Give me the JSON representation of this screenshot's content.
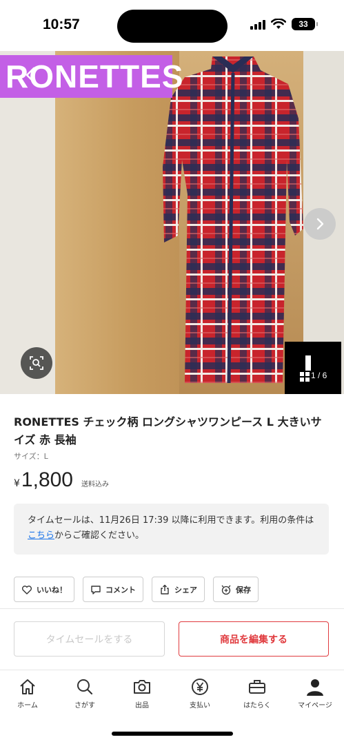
{
  "status_bar": {
    "time": "10:57",
    "battery": "33"
  },
  "photo": {
    "brand_overlay": "RONETTES",
    "counter": "1 / 6",
    "icons": [
      "back-icon",
      "next-arrow-icon",
      "image-search-icon",
      "grid-icon"
    ]
  },
  "product": {
    "title": "RONETTES チェック柄 ロングシャツワンピース L 大きいサイズ 赤 長袖",
    "size": "サイズ：L",
    "currency": "¥",
    "price": "1,800",
    "tax_note": "送料込み"
  },
  "notice": {
    "text_before": "タイムセールは、11月26日 17:39 以降に利用できます。利用の条件は",
    "link": "こちら",
    "text_after": "からご確認ください。"
  },
  "actions": {
    "like": "いいね！",
    "comment": "コメント",
    "share": "シェア",
    "save": "保存"
  },
  "buttons": {
    "time_sale": "タイムセールをする",
    "edit": "商品を編集する"
  },
  "tabbar": {
    "items": [
      {
        "label": "ホーム",
        "icon": "home-icon"
      },
      {
        "label": "さがす",
        "icon": "search-icon"
      },
      {
        "label": "出品",
        "icon": "camera-icon"
      },
      {
        "label": "支払い",
        "icon": "yen-icon"
      },
      {
        "label": "はたらく",
        "icon": "briefcase-icon"
      },
      {
        "label": "マイページ",
        "icon": "person-icon"
      }
    ]
  },
  "colors": {
    "accent": "#e03a3e",
    "brand_overlay": "#c35fe6",
    "link": "#1a73e8"
  }
}
